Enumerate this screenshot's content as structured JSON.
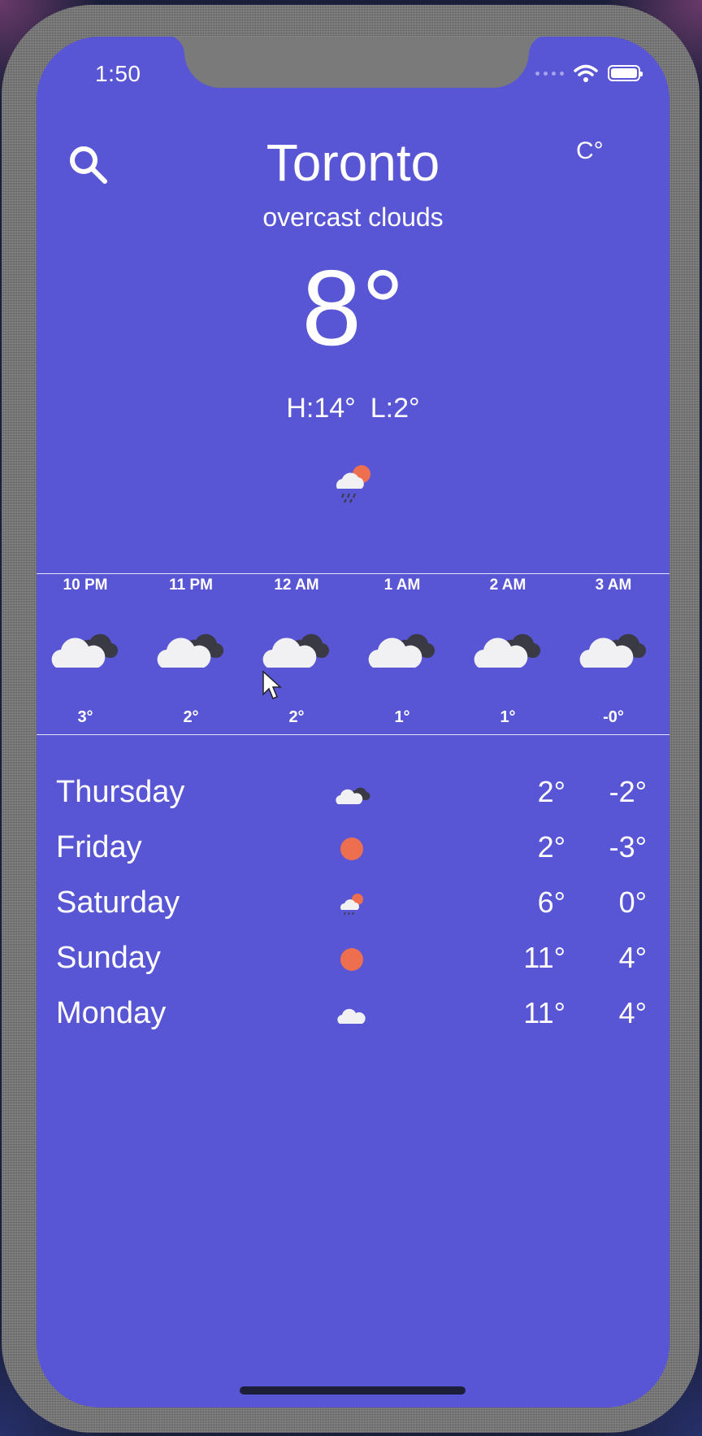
{
  "status_bar": {
    "time": "1:50"
  },
  "header": {
    "city": "Toronto",
    "condition": "overcast clouds",
    "unit_toggle": "C°"
  },
  "current": {
    "temp": "8°",
    "high": "H:14°",
    "low": "L:2°",
    "icon": "sun-cloud-rain-icon"
  },
  "hourly": [
    {
      "time": "10 PM",
      "temp": "3°",
      "icon": "cloud-icon"
    },
    {
      "time": "11 PM",
      "temp": "2°",
      "icon": "cloud-icon"
    },
    {
      "time": "12 AM",
      "temp": "2°",
      "icon": "cloud-icon"
    },
    {
      "time": "1 AM",
      "temp": "1°",
      "icon": "cloud-icon"
    },
    {
      "time": "2 AM",
      "temp": "1°",
      "icon": "cloud-icon"
    },
    {
      "time": "3 AM",
      "temp": "-0°",
      "icon": "cloud-icon"
    }
  ],
  "daily": [
    {
      "day": "Thursday",
      "high": "2°",
      "low": "-2°",
      "icon": "cloud-icon"
    },
    {
      "day": "Friday",
      "high": "2°",
      "low": "-3°",
      "icon": "sun-icon"
    },
    {
      "day": "Saturday",
      "high": "6°",
      "low": "0°",
      "icon": "sun-cloud-rain-icon"
    },
    {
      "day": "Sunday",
      "high": "11°",
      "low": "4°",
      "icon": "sun-icon"
    },
    {
      "day": "Monday",
      "high": "11°",
      "low": "4°",
      "icon": "light-cloud-icon"
    }
  ],
  "colors": {
    "background": "#5956d6",
    "sun": "#ee6f4f",
    "cloud_light": "#f1f1f4",
    "cloud_dark": "#3a3a44"
  }
}
